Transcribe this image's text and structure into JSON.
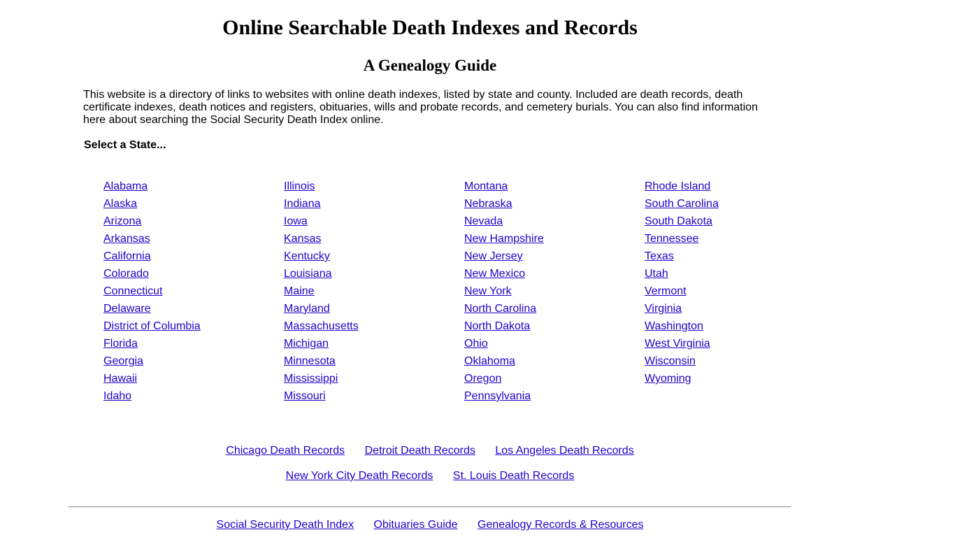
{
  "header": {
    "title": "Online Searchable Death Indexes and Records",
    "subtitle": "A Genealogy Guide"
  },
  "intro": {
    "text": "This website is a directory of links to websites with online death indexes, listed by state and county. Included are death records, death certificate indexes, death notices and registers, obituaries, wills and probate records, and cemetery burials. You can also find information here about searching the Social Security Death Index online."
  },
  "states": {
    "label": "Select a State...",
    "columns": [
      [
        "Alabama",
        "Alaska",
        "Arizona",
        "Arkansas",
        "California",
        "Colorado",
        "Connecticut",
        "Delaware",
        "District of Columbia",
        "Florida",
        "Georgia",
        "Hawaii",
        "Idaho"
      ],
      [
        "Illinois",
        "Indiana",
        "Iowa",
        "Kansas",
        "Kentucky",
        "Louisiana",
        "Maine",
        "Maryland",
        "Massachusetts",
        "Michigan",
        "Minnesota",
        "Mississippi",
        "Missouri"
      ],
      [
        "Montana",
        "Nebraska",
        "Nevada",
        "New Hampshire",
        "New Jersey",
        "New Mexico",
        "New York",
        "North Carolina",
        "North Dakota",
        "Ohio",
        "Oklahoma",
        "Oregon",
        "Pennsylvania"
      ],
      [
        "Rhode Island",
        "South Carolina",
        "South Dakota",
        "Tennessee",
        "Texas",
        "Utah",
        "Vermont",
        "Virginia",
        "Washington",
        "West Virginia",
        "Wisconsin",
        "Wyoming"
      ]
    ]
  },
  "cities": {
    "row1": [
      "Chicago Death Records",
      "Detroit Death Records",
      "Los Angeles Death Records"
    ],
    "row2": [
      "New York City Death Records",
      "St. Louis Death Records"
    ]
  },
  "footer": {
    "links": [
      "Social Security Death Index",
      "Obituaries Guide",
      "Genealogy Records & Resources"
    ]
  },
  "colors": {
    "link": "#2200cc",
    "text": "#000000",
    "background": "#ffffff",
    "divider": "#a0a0a0"
  }
}
